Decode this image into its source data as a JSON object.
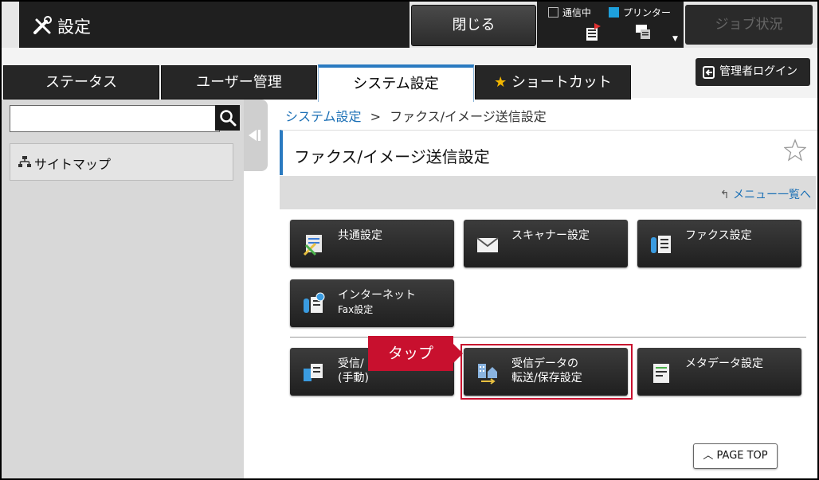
{
  "header": {
    "title": "設定",
    "close_label": "閉じる",
    "status_comm_label": "通信中",
    "status_printer_label": "プリンター",
    "job_status_label": "ジョブ状況",
    "accent_color": "#2a7ac0"
  },
  "tabs": [
    {
      "label": "ステータス"
    },
    {
      "label": "ユーザー管理"
    },
    {
      "label": "システム設定"
    },
    {
      "label": "ショートカット"
    }
  ],
  "admin_login_label": "管理者ログイン",
  "sidebar": {
    "search_placeholder": "",
    "sitemap_label": "サイトマップ"
  },
  "breadcrumb": {
    "parent": "システム設定",
    "separator": ">",
    "current": "ファクス/イメージ送信設定"
  },
  "page_title": "ファクス/イメージ送信設定",
  "menu_list_link": "メニュー一覧へ",
  "tiles": {
    "common": "共通設定",
    "scanner": "スキャナー設定",
    "fax": "ファクス設定",
    "internet_fax_line1": "インターネット",
    "internet_fax_line2": "Fax設定",
    "receive_line1": "受信/",
    "receive_line2": "(手動)",
    "received_data_line1": "受信データの",
    "received_data_line2": "転送/保存設定",
    "metadata": "メタデータ設定"
  },
  "callout": {
    "tap_label": "タップ",
    "color": "#c8102e"
  },
  "page_top_label": "PAGE TOP"
}
